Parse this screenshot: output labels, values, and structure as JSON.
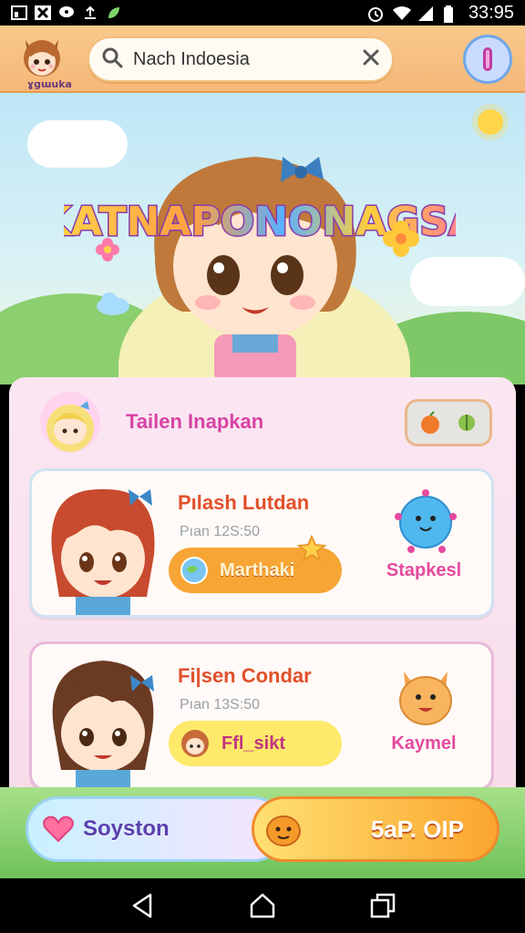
{
  "status_bar": {
    "time": "33:95",
    "icons": [
      "gallery-icon",
      "x-app-icon",
      "chat-icon",
      "upload-icon",
      "leaf-icon",
      "alarm-icon",
      "wifi-icon",
      "signal-icon",
      "battery-icon"
    ]
  },
  "header": {
    "logo_text": "ɣɡɯuka",
    "search": {
      "value": "Nach Indoesia"
    },
    "toggle_icon": "pill-toggle-icon"
  },
  "hero": {
    "title": "KATNAPONONAGSA"
  },
  "user": {
    "name": "Tailen Inapkan",
    "badge_icons": [
      "orange-fruit-icon",
      "green-fruit-icon"
    ]
  },
  "cards": [
    {
      "name": "Pılash Lutdan",
      "sub": "Pıan 12S:50",
      "chip_label": "Marthaki",
      "mascot_label": "Stapkesl"
    },
    {
      "name": "Fi|sen Condar",
      "sub": "Pıan 13S:50",
      "chip_label": "Ffl_sikt",
      "mascot_label": "Kaymel"
    }
  ],
  "actions": {
    "left_label": "Soyston",
    "right_label": "5aP. OIP"
  },
  "colors": {
    "header_bg": "#f6bf80",
    "accent_pink": "#d843a6",
    "accent_orange": "#f7a534",
    "accent_yellow": "#ffe96a"
  }
}
